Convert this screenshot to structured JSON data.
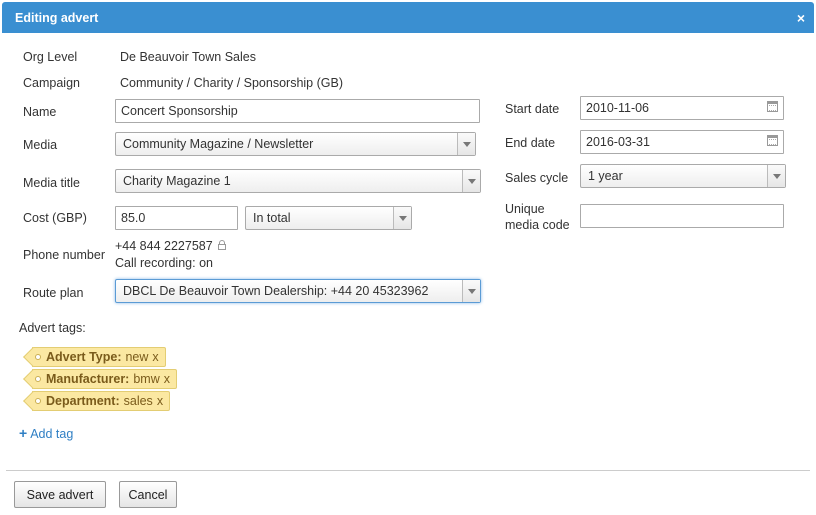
{
  "window": {
    "title": "Editing advert",
    "close_glyph": "×"
  },
  "form": {
    "org_level": {
      "label": "Org Level",
      "value": "De Beauvoir Town Sales"
    },
    "campaign": {
      "label": "Campaign",
      "value": "Community / Charity / Sponsorship (GB)"
    },
    "name": {
      "label": "Name",
      "value": "Concert Sponsorship"
    },
    "media": {
      "label": "Media",
      "value": "Community Magazine / Newsletter"
    },
    "media_title": {
      "label": "Media title",
      "value": "Charity Magazine 1"
    },
    "cost": {
      "label": "Cost (GBP)",
      "value": "85.0",
      "mode": "In total"
    },
    "phone": {
      "label": "Phone number",
      "number": "+44 844 2227587",
      "recording": "Call recording: on"
    },
    "route_plan": {
      "label": "Route plan",
      "value": "DBCL De Beauvoir Town Dealership: +44 20 45323962"
    },
    "start_date": {
      "label": "Start date",
      "value": "2010-11-06"
    },
    "end_date": {
      "label": "End date",
      "value": "2016-03-31"
    },
    "sales_cycle": {
      "label": "Sales cycle",
      "value": "1 year"
    },
    "unique_media_code": {
      "label_line1": "Unique",
      "label_line2": "media code",
      "value": ""
    }
  },
  "tags": {
    "label": "Advert tags:",
    "items": [
      {
        "key": "Advert Type:",
        "value": "new",
        "remove": "x"
      },
      {
        "key": "Manufacturer:",
        "value": "bmw",
        "remove": "x"
      },
      {
        "key": "Department:",
        "value": "sales",
        "remove": "x"
      }
    ],
    "add_label": "Add tag",
    "add_glyph": "+"
  },
  "actions": {
    "save": "Save advert",
    "cancel": "Cancel"
  },
  "icons": {
    "close": "close-icon",
    "calendar": "calendar-icon",
    "lock": "lock-icon",
    "plus": "plus-icon"
  },
  "colors": {
    "titlebar": "#3a8fd1",
    "tag_bg": "#fbe8a2",
    "link": "#2f7fc4"
  }
}
